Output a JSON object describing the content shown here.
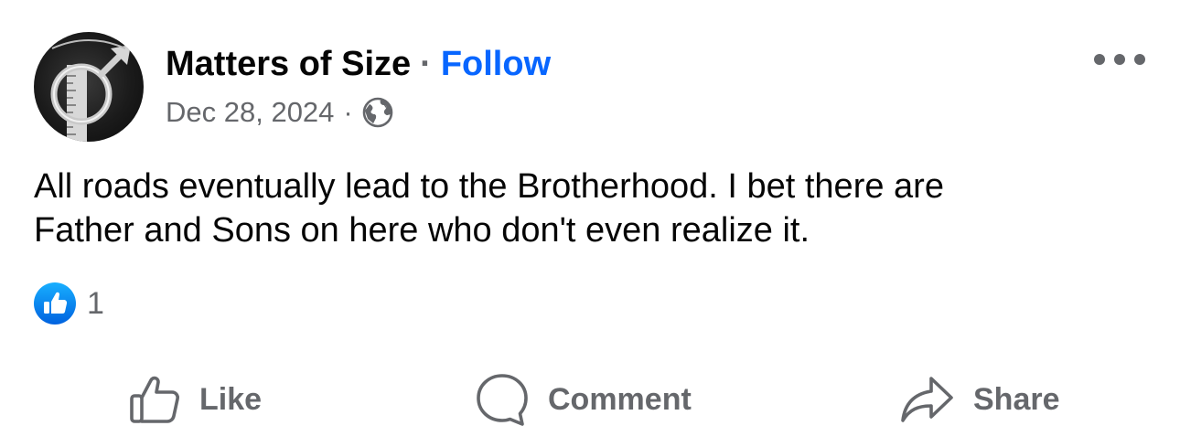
{
  "post": {
    "page_name": "Matters of Size",
    "separator": "·",
    "follow_label": "Follow",
    "date": "Dec 28, 2024",
    "meta_separator": "·",
    "audience_icon": "globe-icon",
    "more_icon": "more-horizontal-icon",
    "text_lines": [
      "All roads eventually lead to the Brotherhood. I bet there are",
      "Father and Sons on here who don't even realize it."
    ],
    "reactions": {
      "icon": "like-reaction-icon",
      "count": "1"
    },
    "actions": {
      "like": {
        "label": "Like",
        "icon": "thumbs-up-icon"
      },
      "comment": {
        "label": "Comment",
        "icon": "comment-icon"
      },
      "share": {
        "label": "Share",
        "icon": "share-arrow-icon"
      }
    }
  },
  "colors": {
    "text_primary": "#050505",
    "text_secondary": "#65676b",
    "link_blue": "#0866ff",
    "background": "#ffffff"
  }
}
